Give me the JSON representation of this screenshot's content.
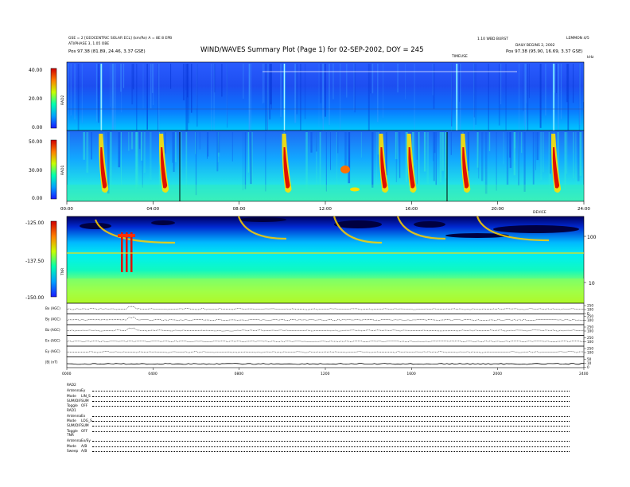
{
  "header": {
    "title": "WIND/WAVES Summary Plot (Page 1) for 02-SEP-2002, DOY = 245",
    "left_line1": "GSE = 2 [GEOCENTRIC SOLAR ECL] (km/Re) A = 8E 8 EPB",
    "left_line2": "ATI/PHASE 3, 1.05 OBE",
    "left_pos": "Pos    97.38 (81.89, 24.46, 3.37 GSE)",
    "right_line1": "LEMMON 4/5",
    "right_line2": "1.10 WBD BURST",
    "right_line3": "DAILY BEGINS 2, 2002",
    "right_pos": "Pos    97.38 (95.90, 16.69, 3.37 GSE)",
    "top_unit": "kHz",
    "top_scale_label": "TIMEUSE"
  },
  "chart_data": [
    {
      "type": "heatmap",
      "name": "RAD2",
      "colorbar_ticks": [
        "40.00",
        "20.00",
        "0.00"
      ],
      "colorbar_range": [
        0,
        40
      ],
      "bursts_hours": [
        1.6,
        10.1,
        18.1,
        22.6
      ]
    },
    {
      "type": "heatmap",
      "name": "RAD1",
      "colorbar_ticks": [
        "50.00",
        "30.00",
        "0.00"
      ],
      "colorbar_range": [
        0,
        50
      ],
      "bursts_hours": [
        1.6,
        4.4,
        10.1,
        14.6,
        15.9,
        18.4,
        22.6
      ],
      "time_ticks": [
        "00:00",
        "04:00",
        "08:00",
        "12:00",
        "16:00",
        "20:00",
        "24:00"
      ],
      "time_axis_label": "DEVICE"
    },
    {
      "type": "heatmap",
      "name": "TNR",
      "colorbar_ticks": [
        "-125.00",
        "-137.50",
        "-150.00"
      ],
      "colorbar_range": [
        -150,
        -125
      ],
      "right_ticks": [
        "100",
        "10"
      ]
    },
    {
      "type": "line",
      "panels": [
        {
          "label": "Bx (AGC)",
          "right_ticks": [
            "250",
            "100",
            "0"
          ]
        },
        {
          "label": "By (AGC)",
          "right_ticks": [
            "250",
            "100"
          ]
        },
        {
          "label": "Bz (AGC)",
          "right_ticks": [
            "250",
            "100"
          ]
        },
        {
          "label": "Ex (AGC)",
          "right_ticks": [
            "250",
            "100"
          ]
        },
        {
          "label": "Ey (AGC)",
          "right_ticks": [
            "250",
            "100"
          ]
        },
        {
          "label": "|B| (nT)",
          "right_ticks": [
            "50",
            "10",
            "0"
          ]
        }
      ],
      "time_ticks": [
        "0000",
        "0400",
        "0800",
        "1200",
        "1600",
        "2000",
        "2400"
      ]
    }
  ],
  "status": {
    "rad2_title": "RAD2",
    "rad2_rows": [
      {
        "label": "Antenna",
        "value": "Ey"
      },
      {
        "label": "Mode",
        "value": "LIN_S"
      },
      {
        "label": "SUM/DIF",
        "value": "SUM"
      },
      {
        "label": "Toggle",
        "value": "OFF"
      }
    ],
    "rad1_title": "RAD1",
    "rad1_rows": [
      {
        "label": "Antenna",
        "value": "Ex"
      },
      {
        "label": "Mode",
        "value": "LOG_S"
      },
      {
        "label": "SUM/DIF",
        "value": "SUM"
      },
      {
        "label": "Toggle",
        "value": "OFF"
      }
    ],
    "tnr_title": "TNR",
    "tnr_rows": [
      {
        "label": "Antenna",
        "value": "Ex/Ey"
      },
      {
        "label": "Mode",
        "value": "A/B"
      },
      {
        "label": "Sweep",
        "value": "A/B"
      }
    ]
  }
}
